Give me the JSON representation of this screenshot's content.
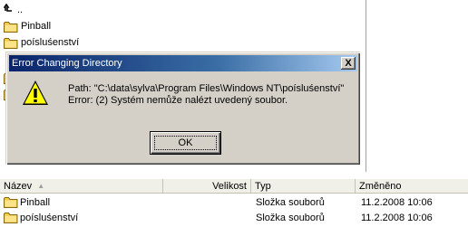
{
  "tree": {
    "up_label": "..",
    "items": [
      {
        "label": "Pinball",
        "icon": "folder-icon"
      },
      {
        "label": "poísluśenství",
        "icon": "folder-icon"
      }
    ]
  },
  "dialog": {
    "title": "Error Changing Directory",
    "close_label": "X",
    "icon": "warning-icon",
    "line1": "Path: \"C:\\data\\sylva\\Program Files\\Windows NT\\poísluśenství\"",
    "line2": "Error: (2) Systém nemůže nalézt uvedený soubor.",
    "ok_label": "OK"
  },
  "list": {
    "columns": [
      {
        "label": "Název",
        "sort": "ascending"
      },
      {
        "label": "Velikost"
      },
      {
        "label": "Typ"
      },
      {
        "label": "Změněno"
      }
    ],
    "rows": [
      {
        "name": "Pinball",
        "size": "",
        "type": "Složka souborů",
        "modified": "11.2.2008 10:06"
      },
      {
        "name": "poísluśenství",
        "size": "",
        "type": "Složka souborů",
        "modified": "11.2.2008 10:06"
      }
    ]
  },
  "colors": {
    "folder": "#f2c94c",
    "title_start": "#0a246a",
    "title_end": "#a6caf0",
    "dialog_face": "#d4d0c8"
  }
}
